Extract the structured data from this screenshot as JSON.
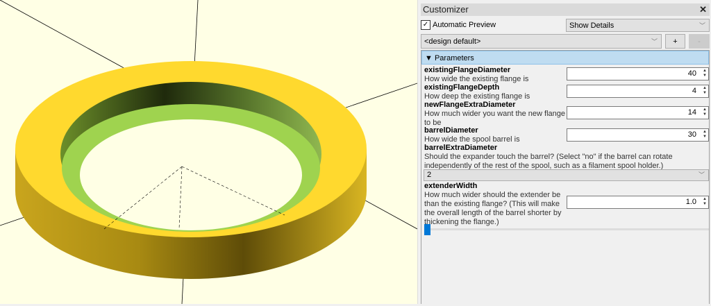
{
  "viewport": {
    "background": "#ffffe5",
    "ring_top": "#ffd92e",
    "ring_inner": "#9fd34f"
  },
  "customizer": {
    "title": "Customizer",
    "close": "✕",
    "automatic_preview": {
      "label": "Automatic Preview",
      "checked": true,
      "check": "✓"
    },
    "details_select": "Show Details",
    "preset_select": "<design default>",
    "add_label": "+",
    "remove_label": "-",
    "section": {
      "arrow": "▼",
      "label": "Parameters"
    },
    "params": [
      {
        "name": "existingFlangeDiameter",
        "desc": "How wide the existing flange is",
        "value": "40"
      },
      {
        "name": "existingFlangeDepth",
        "desc": "How deep the existing flange is",
        "value": "4"
      },
      {
        "name": "newFlangeExtraDiameter",
        "desc": "How much wider you want the new flange to be",
        "value": "14"
      },
      {
        "name": "barrelDiameter",
        "desc": "How wide the spool barrel is",
        "value": "30"
      },
      {
        "name": "barrelExtraDiameter",
        "desc": "Should the expander touch the barrel? (Select \"no\" if the barrel can rotate independently of the rest of the spool, such as a filament spool holder.)",
        "value": "2"
      },
      {
        "name": "extenderWidth",
        "desc": "How much wider should the extender be than the existing flange? (This will make the overall length of the barrel shorter by thickening the flange.)",
        "value": "1.0",
        "slider_fraction": 0.0
      }
    ]
  }
}
